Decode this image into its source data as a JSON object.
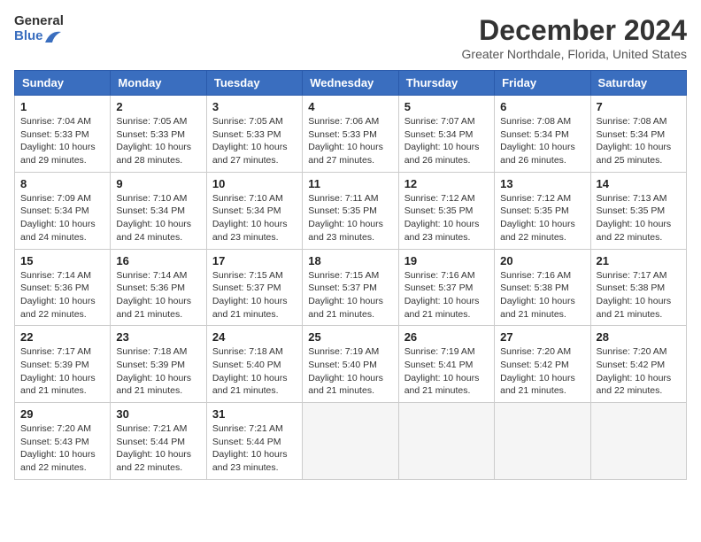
{
  "header": {
    "logo_line1": "General",
    "logo_line2": "Blue",
    "month_title": "December 2024",
    "location": "Greater Northdale, Florida, United States"
  },
  "days_of_week": [
    "Sunday",
    "Monday",
    "Tuesday",
    "Wednesday",
    "Thursday",
    "Friday",
    "Saturday"
  ],
  "weeks": [
    [
      {
        "day": "1",
        "sunrise": "7:04 AM",
        "sunset": "5:33 PM",
        "daylight": "10 hours and 29 minutes."
      },
      {
        "day": "2",
        "sunrise": "7:05 AM",
        "sunset": "5:33 PM",
        "daylight": "10 hours and 28 minutes."
      },
      {
        "day": "3",
        "sunrise": "7:05 AM",
        "sunset": "5:33 PM",
        "daylight": "10 hours and 27 minutes."
      },
      {
        "day": "4",
        "sunrise": "7:06 AM",
        "sunset": "5:33 PM",
        "daylight": "10 hours and 27 minutes."
      },
      {
        "day": "5",
        "sunrise": "7:07 AM",
        "sunset": "5:34 PM",
        "daylight": "10 hours and 26 minutes."
      },
      {
        "day": "6",
        "sunrise": "7:08 AM",
        "sunset": "5:34 PM",
        "daylight": "10 hours and 26 minutes."
      },
      {
        "day": "7",
        "sunrise": "7:08 AM",
        "sunset": "5:34 PM",
        "daylight": "10 hours and 25 minutes."
      }
    ],
    [
      {
        "day": "8",
        "sunrise": "7:09 AM",
        "sunset": "5:34 PM",
        "daylight": "10 hours and 24 minutes."
      },
      {
        "day": "9",
        "sunrise": "7:10 AM",
        "sunset": "5:34 PM",
        "daylight": "10 hours and 24 minutes."
      },
      {
        "day": "10",
        "sunrise": "7:10 AM",
        "sunset": "5:34 PM",
        "daylight": "10 hours and 23 minutes."
      },
      {
        "day": "11",
        "sunrise": "7:11 AM",
        "sunset": "5:35 PM",
        "daylight": "10 hours and 23 minutes."
      },
      {
        "day": "12",
        "sunrise": "7:12 AM",
        "sunset": "5:35 PM",
        "daylight": "10 hours and 23 minutes."
      },
      {
        "day": "13",
        "sunrise": "7:12 AM",
        "sunset": "5:35 PM",
        "daylight": "10 hours and 22 minutes."
      },
      {
        "day": "14",
        "sunrise": "7:13 AM",
        "sunset": "5:35 PM",
        "daylight": "10 hours and 22 minutes."
      }
    ],
    [
      {
        "day": "15",
        "sunrise": "7:14 AM",
        "sunset": "5:36 PM",
        "daylight": "10 hours and 22 minutes."
      },
      {
        "day": "16",
        "sunrise": "7:14 AM",
        "sunset": "5:36 PM",
        "daylight": "10 hours and 21 minutes."
      },
      {
        "day": "17",
        "sunrise": "7:15 AM",
        "sunset": "5:37 PM",
        "daylight": "10 hours and 21 minutes."
      },
      {
        "day": "18",
        "sunrise": "7:15 AM",
        "sunset": "5:37 PM",
        "daylight": "10 hours and 21 minutes."
      },
      {
        "day": "19",
        "sunrise": "7:16 AM",
        "sunset": "5:37 PM",
        "daylight": "10 hours and 21 minutes."
      },
      {
        "day": "20",
        "sunrise": "7:16 AM",
        "sunset": "5:38 PM",
        "daylight": "10 hours and 21 minutes."
      },
      {
        "day": "21",
        "sunrise": "7:17 AM",
        "sunset": "5:38 PM",
        "daylight": "10 hours and 21 minutes."
      }
    ],
    [
      {
        "day": "22",
        "sunrise": "7:17 AM",
        "sunset": "5:39 PM",
        "daylight": "10 hours and 21 minutes."
      },
      {
        "day": "23",
        "sunrise": "7:18 AM",
        "sunset": "5:39 PM",
        "daylight": "10 hours and 21 minutes."
      },
      {
        "day": "24",
        "sunrise": "7:18 AM",
        "sunset": "5:40 PM",
        "daylight": "10 hours and 21 minutes."
      },
      {
        "day": "25",
        "sunrise": "7:19 AM",
        "sunset": "5:40 PM",
        "daylight": "10 hours and 21 minutes."
      },
      {
        "day": "26",
        "sunrise": "7:19 AM",
        "sunset": "5:41 PM",
        "daylight": "10 hours and 21 minutes."
      },
      {
        "day": "27",
        "sunrise": "7:20 AM",
        "sunset": "5:42 PM",
        "daylight": "10 hours and 21 minutes."
      },
      {
        "day": "28",
        "sunrise": "7:20 AM",
        "sunset": "5:42 PM",
        "daylight": "10 hours and 22 minutes."
      }
    ],
    [
      {
        "day": "29",
        "sunrise": "7:20 AM",
        "sunset": "5:43 PM",
        "daylight": "10 hours and 22 minutes."
      },
      {
        "day": "30",
        "sunrise": "7:21 AM",
        "sunset": "5:44 PM",
        "daylight": "10 hours and 22 minutes."
      },
      {
        "day": "31",
        "sunrise": "7:21 AM",
        "sunset": "5:44 PM",
        "daylight": "10 hours and 23 minutes."
      },
      null,
      null,
      null,
      null
    ]
  ]
}
